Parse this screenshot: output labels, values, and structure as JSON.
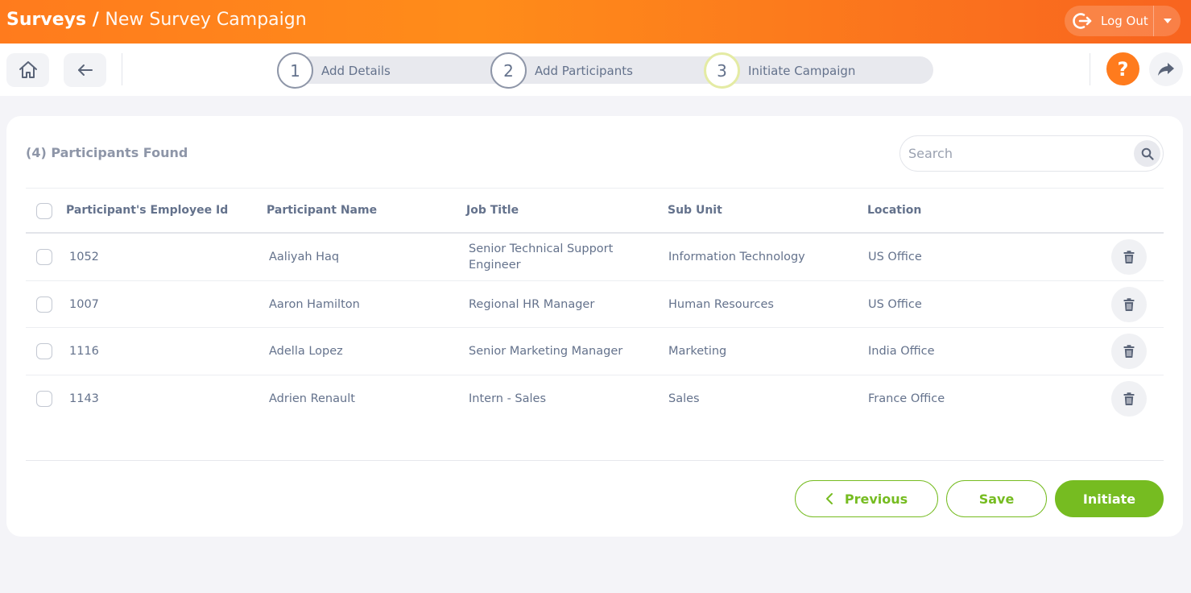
{
  "header": {
    "module": "Surveys",
    "separator": " / ",
    "page": "New Survey Campaign",
    "logout_label": "Log Out"
  },
  "steps": [
    {
      "number": "1",
      "label": "Add Details"
    },
    {
      "number": "2",
      "label": "Add Participants"
    },
    {
      "number": "3",
      "label": "Initiate Campaign"
    }
  ],
  "active_step": "3",
  "toolbar": {
    "help_label": "?"
  },
  "list": {
    "found_label": "(4) Participants Found",
    "search_placeholder": "Search"
  },
  "table": {
    "columns": [
      "Participant's Employee Id",
      "Participant Name",
      "Job Title",
      "Sub Unit",
      "Location"
    ],
    "rows": [
      {
        "id": "1052",
        "name": "Aaliyah Haq",
        "job": "Senior Technical Support Engineer",
        "subunit": "Information Technology",
        "location": "US Office"
      },
      {
        "id": "1007",
        "name": "Aaron Hamilton",
        "job": "Regional HR Manager",
        "subunit": "Human Resources",
        "location": "US Office"
      },
      {
        "id": "1116",
        "name": "Adella Lopez",
        "job": "Senior Marketing Manager",
        "subunit": "Marketing",
        "location": "India Office"
      },
      {
        "id": "1143",
        "name": "Adrien Renault",
        "job": "Intern - Sales",
        "subunit": "Sales",
        "location": "France Office"
      }
    ]
  },
  "actions": {
    "previous_label": "Previous",
    "save_label": "Save",
    "initiate_label": "Initiate"
  },
  "colors": {
    "brand_orange": "#ff7b1d",
    "accent_green": "#76bc21",
    "text": "#64728c"
  },
  "icons": [
    "home-icon",
    "arrow-left-icon",
    "logout-icon",
    "caret-down-icon",
    "question-icon",
    "share-icon",
    "search-icon",
    "trash-icon",
    "chevron-left-icon"
  ]
}
